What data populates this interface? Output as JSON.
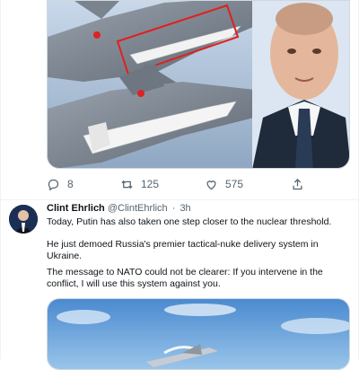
{
  "tweet_top": {
    "media_alt": "fighter jet with missile and portrait",
    "actions": {
      "reply_count": "8",
      "retweet_count": "125",
      "like_count": "575"
    }
  },
  "tweet": {
    "author_name": "Clint Ehrlich",
    "author_handle": "@ClintEhrlich",
    "separator": "·",
    "time": "3h",
    "paragraphs": [
      "Today, Putin has also taken one step closer to the nuclear threshold.",
      "He just demoed Russia's premier tactical-nuke delivery system in Ukraine.",
      "The message to NATO could not be clearer: If you intervene in the conflict, I will use this system against you."
    ]
  },
  "colors": {
    "text_primary": "#0f1419",
    "text_secondary": "#536471",
    "border": "#cfd9de",
    "highlight_box": "#e0201e"
  },
  "icons": [
    "reply-icon",
    "retweet-icon",
    "like-icon",
    "share-icon"
  ]
}
